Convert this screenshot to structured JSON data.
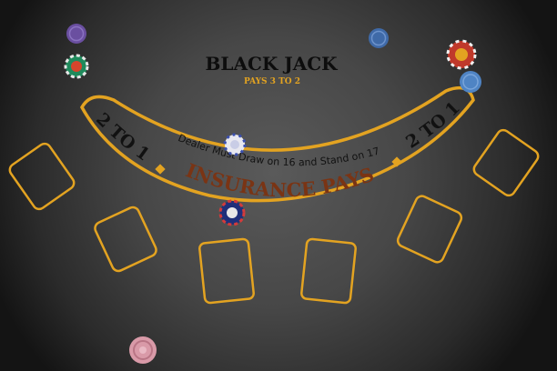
{
  "table": {
    "title": "BLACK JACK",
    "subtitle": "PAYS 3 TO 2",
    "rule_text": "Dealer Must Draw on 16 and Stand on 17",
    "insurance_text": "INSURANCE PAYS",
    "insurance_left": "2 TO 1",
    "insurance_right": "2 TO 1",
    "felt_color": "#4a4a4a",
    "line_color": "#e3a321",
    "insurance_text_color": "#7a3414"
  },
  "betting_spots": [
    {
      "id": "spot-1"
    },
    {
      "id": "spot-2"
    },
    {
      "id": "spot-3"
    },
    {
      "id": "spot-4"
    },
    {
      "id": "spot-5"
    },
    {
      "id": "spot-6"
    },
    {
      "id": "spot-7"
    }
  ],
  "chips": [
    {
      "id": "purple-chip",
      "color": "#6a4fa0"
    },
    {
      "id": "green-chip",
      "color": "#1f8a5c"
    },
    {
      "id": "blue-chip-top",
      "color": "#3f6aa8"
    },
    {
      "id": "red-chip",
      "color": "#c0392b"
    },
    {
      "id": "lightblue-chip",
      "color": "#4f84c4"
    },
    {
      "id": "white-chip",
      "color": "#e8e8f0"
    },
    {
      "id": "navy-chip",
      "color": "#1f2f7a"
    },
    {
      "id": "pink-chip",
      "color": "#d99aa8"
    }
  ]
}
